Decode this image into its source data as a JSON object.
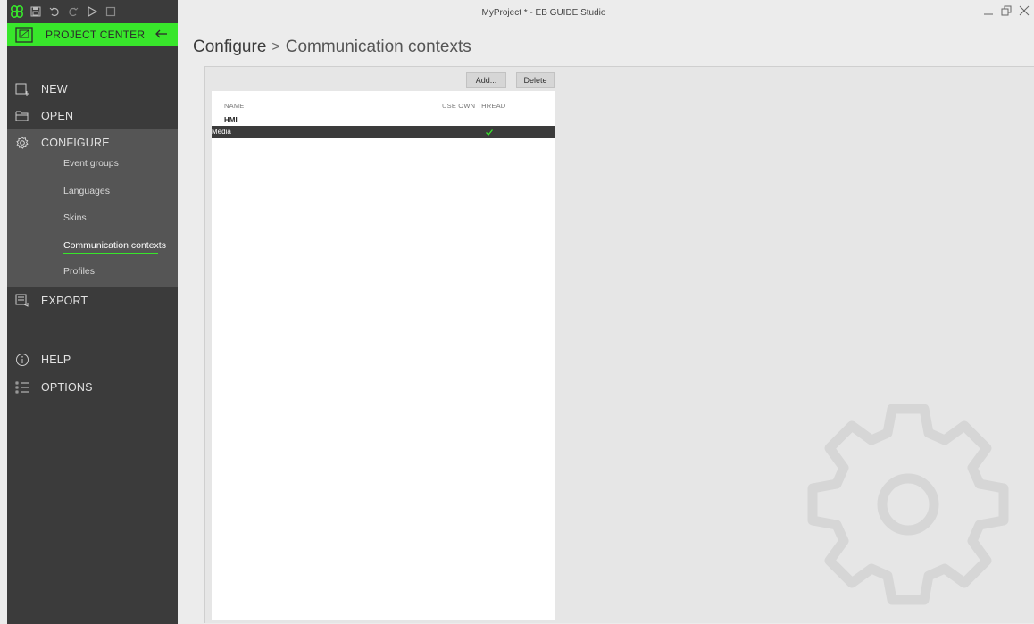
{
  "window": {
    "title": "MyProject * - EB GUIDE Studio"
  },
  "colors": {
    "accent": "#38e62b",
    "sidebar": "#3b3b3b",
    "sidebar_selected": "#555555",
    "pane": "#e6e6e6"
  },
  "quickbar": {
    "icons": [
      "eb-logo-icon",
      "save-icon",
      "undo-icon",
      "redo-icon",
      "play-icon",
      "stop-icon"
    ]
  },
  "sidebar": {
    "project_center": "PROJECT CENTER",
    "items": [
      {
        "label": "NEW",
        "icon": "new-project-icon"
      },
      {
        "label": "OPEN",
        "icon": "folder-icon"
      },
      {
        "label": "CONFIGURE",
        "icon": "gear-icon"
      },
      {
        "label": "EXPORT",
        "icon": "export-icon"
      },
      {
        "label": "HELP",
        "icon": "info-icon"
      },
      {
        "label": "OPTIONS",
        "icon": "options-list-icon"
      }
    ],
    "configure_sub": [
      {
        "label": "Event groups"
      },
      {
        "label": "Languages"
      },
      {
        "label": "Skins"
      },
      {
        "label": "Communication contexts",
        "active": true
      },
      {
        "label": "Profiles"
      }
    ]
  },
  "breadcrumb": {
    "root": "Configure",
    "separator": ">",
    "current": "Communication contexts"
  },
  "toolbar": {
    "add_label": "Add...",
    "delete_label": "Delete"
  },
  "table": {
    "columns": [
      "NAME",
      "USE OWN THREAD"
    ],
    "group": "HMI",
    "rows": [
      {
        "name": "Media",
        "use_own_thread": true
      }
    ]
  }
}
